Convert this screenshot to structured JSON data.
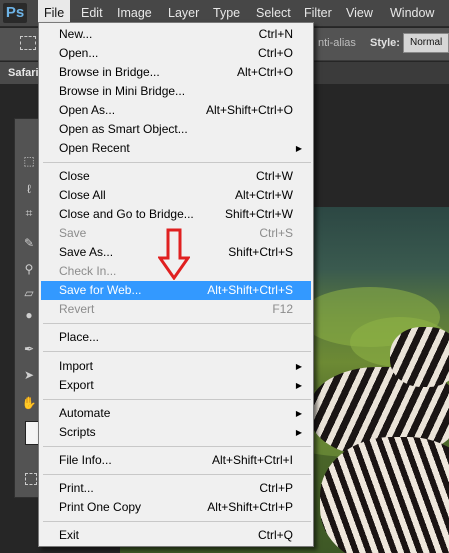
{
  "app": {
    "logo": "Ps"
  },
  "menubar": {
    "items": [
      {
        "label": "File"
      },
      {
        "label": "Edit"
      },
      {
        "label": "Image"
      },
      {
        "label": "Layer"
      },
      {
        "label": "Type"
      },
      {
        "label": "Select"
      },
      {
        "label": "Filter"
      },
      {
        "label": "View"
      },
      {
        "label": "Window"
      }
    ]
  },
  "options_bar": {
    "antialias_label": "nti-alias",
    "style_label": "Style:",
    "style_value": "Normal"
  },
  "document": {
    "tab_label": "Safari"
  },
  "file_menu": {
    "items": [
      {
        "label": "New...",
        "shortcut": "Ctrl+N"
      },
      {
        "label": "Open...",
        "shortcut": "Ctrl+O"
      },
      {
        "label": "Browse in Bridge...",
        "shortcut": "Alt+Ctrl+O"
      },
      {
        "label": "Browse in Mini Bridge...",
        "shortcut": ""
      },
      {
        "label": "Open As...",
        "shortcut": "Alt+Shift+Ctrl+O"
      },
      {
        "label": "Open as Smart Object...",
        "shortcut": ""
      },
      {
        "label": "Open Recent",
        "shortcut": ""
      },
      {
        "label": "Close",
        "shortcut": "Ctrl+W"
      },
      {
        "label": "Close All",
        "shortcut": "Alt+Ctrl+W"
      },
      {
        "label": "Close and Go to Bridge...",
        "shortcut": "Shift+Ctrl+W"
      },
      {
        "label": "Save",
        "shortcut": "Ctrl+S"
      },
      {
        "label": "Save As...",
        "shortcut": "Shift+Ctrl+S"
      },
      {
        "label": "Check In...",
        "shortcut": ""
      },
      {
        "label": "Save for Web...",
        "shortcut": "Alt+Shift+Ctrl+S"
      },
      {
        "label": "Revert",
        "shortcut": "F12"
      },
      {
        "label": "Place...",
        "shortcut": ""
      },
      {
        "label": "Import",
        "shortcut": ""
      },
      {
        "label": "Export",
        "shortcut": ""
      },
      {
        "label": "Automate",
        "shortcut": ""
      },
      {
        "label": "Scripts",
        "shortcut": ""
      },
      {
        "label": "File Info...",
        "shortcut": "Alt+Shift+Ctrl+I"
      },
      {
        "label": "Print...",
        "shortcut": "Ctrl+P"
      },
      {
        "label": "Print One Copy",
        "shortcut": "Alt+Shift+Ctrl+P"
      },
      {
        "label": "Exit",
        "shortcut": "Ctrl+Q"
      }
    ],
    "submenu_arrow": "▶",
    "highlight_color": "#3399ff",
    "annotation_arrow_color": "#e02020"
  }
}
